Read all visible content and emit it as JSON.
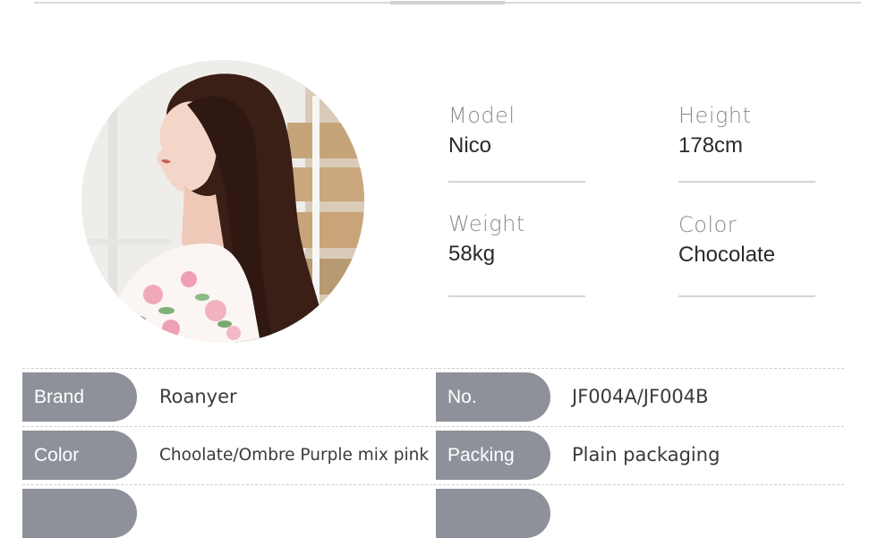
{
  "model_card": {
    "photo": {
      "description_icon": "portrait-photo"
    },
    "specs": [
      {
        "label": "Model",
        "value": "Nico"
      },
      {
        "label": "Height",
        "value": "178cm"
      },
      {
        "label": "Weight",
        "value": "58kg"
      },
      {
        "label": "Color",
        "value": "Chocolate"
      }
    ]
  },
  "details_table": {
    "rows": [
      {
        "left_label": "Brand",
        "left_value": "Roanyer",
        "right_label": "No.",
        "right_value": "JF004A/JF004B"
      },
      {
        "left_label": "Color",
        "left_value": "Choolate/Ombre Purple mix pink",
        "right_label": "Packing",
        "right_value": "Plain packaging"
      }
    ]
  },
  "colors": {
    "tag_bg": "#8e9199",
    "divider": "#d4d4d4",
    "hair": "#3a1f17"
  }
}
